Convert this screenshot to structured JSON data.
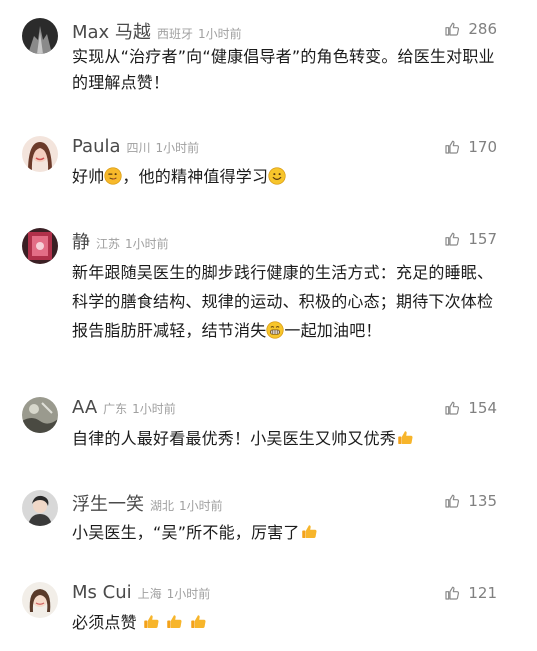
{
  "comments": [
    {
      "name": "Max 马越",
      "location": "西班牙",
      "time": "1小时前",
      "likes": "286",
      "text": "实现从“治疗者”向“健康倡导者”的角色转变。给医生对职业的理解点赞！"
    },
    {
      "name": "Paula",
      "location": "四川",
      "time": "1小时前",
      "likes": "170",
      "text_a": "好帅",
      "text_b": "，他的精神值得学习"
    },
    {
      "name": "静",
      "location": "江苏",
      "time": "1小时前",
      "likes": "157",
      "text_a": "新年跟随吴医生的脚步践行健康的生活方式：充足的睡眠、科学的膳食结构、规律的运动、积极的心态；期待下次体检报告脂肪肝减轻，结节消失",
      "text_b": "一起加油吧！"
    },
    {
      "name": "AA",
      "location": "广东",
      "time": "1小时前",
      "likes": "154",
      "text": "自律的人最好看最优秀！小吴医生又帅又优秀"
    },
    {
      "name": "浮生一笑",
      "location": "湖北",
      "time": "1小时前",
      "likes": "135",
      "text": "小吴医生，“吴”所不能，厉害了"
    },
    {
      "name": "Ms Cui",
      "location": "上海",
      "time": "1小时前",
      "likes": "121",
      "text": "必须点赞"
    }
  ],
  "icons": {
    "like": "thumbs-up-outline-icon",
    "emoji_wink": "wink-tongue-emoji",
    "emoji_smile": "smile-emoji",
    "emoji_grin": "grin-emoji",
    "emoji_thumbs": "thumbs-up-emoji"
  }
}
